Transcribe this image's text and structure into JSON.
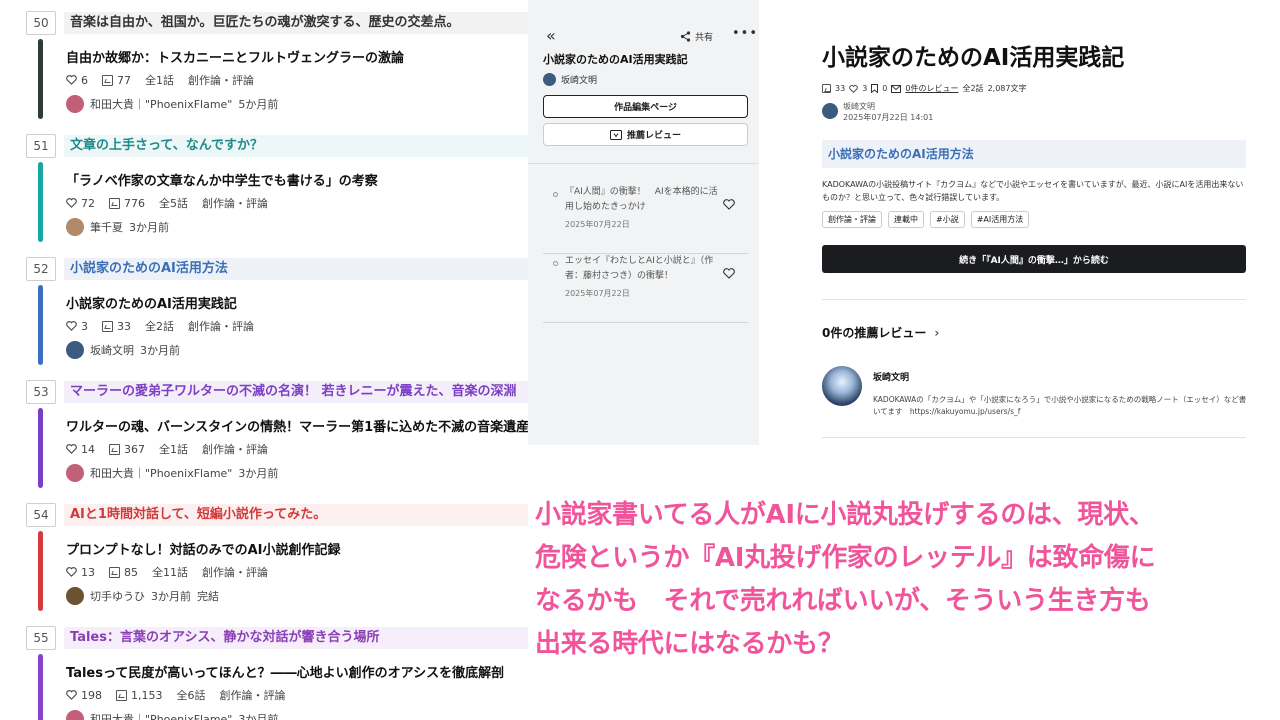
{
  "ranking": [
    {
      "rank": "50",
      "headline": "音楽は自由か、祖国か。巨匠たちの魂が激突する、歴史の交差点。",
      "headline_color": "#333333",
      "headline_bg": "#f2f2f2",
      "bar_color": "#2f3b3b",
      "title": "自由か故郷か：トスカニーニとフルトヴェングラーの激論",
      "hearts": "6",
      "pv": "77",
      "episodes": "全1話",
      "genre": "創作論・評論",
      "author": "和田大貴｜\"PhoenixFlame\"",
      "time": "5か月前",
      "status": "",
      "avatar_color": "#c2607a"
    },
    {
      "rank": "51",
      "headline": "文章の上手さって、なんですか？",
      "headline_color": "#1f8a8a",
      "headline_bg": "#eef7f7",
      "bar_color": "#17a6a6",
      "title": "「ラノベ作家の文章なんか中学生でも書ける」の考察",
      "hearts": "72",
      "pv": "776",
      "episodes": "全5話",
      "genre": "創作論・評論",
      "author": "筆千夏",
      "time": "3か月前",
      "status": "",
      "avatar_color": "#b08a6a"
    },
    {
      "rank": "52",
      "headline": "小説家のためのAI活用方法",
      "headline_color": "#3a6fb5",
      "headline_bg": "#eef2f8",
      "bar_color": "#3c6fc0",
      "title": "小説家のためのAI活用実践記",
      "hearts": "3",
      "pv": "33",
      "episodes": "全2話",
      "genre": "創作論・評論",
      "author": "坂崎文明",
      "time": "3か月前",
      "status": "",
      "avatar_color": "#3d5a80"
    },
    {
      "rank": "53",
      "headline": "マーラーの愛弟子ワルターの不滅の名演！ 若きレニーが震えた、音楽の深淵",
      "headline_color": "#7b3fc2",
      "headline_bg": "#f4eefa",
      "bar_color": "#7a3fc8",
      "title": "ワルターの魂、バーンスタインの情熱！マーラー第1番に込めた不滅の音楽遺産",
      "hearts": "14",
      "pv": "367",
      "episodes": "全1話",
      "genre": "創作論・評論",
      "author": "和田大貴｜\"PhoenixFlame\"",
      "time": "3か月前",
      "status": "",
      "avatar_color": "#c2607a"
    },
    {
      "rank": "54",
      "headline": "AIと1時間対話して、短編小説作ってみた。",
      "headline_color": "#d23a3a",
      "headline_bg": "#fcefef",
      "bar_color": "#d63a3a",
      "title": "プロンプトなし！対話のみでのAI小説創作記録",
      "hearts": "13",
      "pv": "85",
      "episodes": "全11話",
      "genre": "創作論・評論",
      "author": "切手ゆうひ",
      "time": "3か月前",
      "status": "完結",
      "avatar_color": "#6b5230"
    },
    {
      "rank": "55",
      "headline": "Tales：言葉のオアシス、静かな対話が響き合う場所",
      "headline_color": "#8a3fb5",
      "headline_bg": "#f6eefa",
      "bar_color": "#8a42c8",
      "title": "Talesって民度が高いってほんと？――心地よい創作のオアシスを徹底解剖",
      "hearts": "198",
      "pv": "1,153",
      "episodes": "全6話",
      "genre": "創作論・評論",
      "author": "和田大貴｜\"PhoenixFlame\"",
      "time": "3か月前",
      "status": "",
      "avatar_color": "#c2607a"
    }
  ],
  "sidebar": {
    "back_icon": "double-chevron-left",
    "share_label": "共有",
    "more_label": "•••",
    "work_title": "小説家のためのAI活用実践記",
    "author": "坂崎文明",
    "edit_button": "作品編集ページ",
    "review_button": "推薦レビュー",
    "episodes": [
      {
        "title": "『AI人間』の衝撃！　AIを本格的に活用し始めたきっかけ",
        "date": "2025年07月22日"
      },
      {
        "title": "エッセイ『わたしとAIと小説と』（作者：藤村さつき）の衝撃！",
        "date": "2025年07月22日"
      }
    ]
  },
  "work": {
    "title": "小説家のためのAI活用実践記",
    "pv": "33",
    "hearts": "3",
    "bookmarks": "0",
    "reviews": "0件のレビュー",
    "episodes": "全2話",
    "chars": "2,087文字",
    "author": "坂崎文明",
    "updated": "2025年07月22日 14:01",
    "catchphrase": "小説家のためのAI活用方法",
    "description": "KADOKAWAの小説投稿サイト『カクヨム』などで小説やエッセイを書いていますが、最近、小説にAIを活用出来ないものか？と思い立って、色々試行錯誤しています。",
    "tags": [
      "創作論・評論",
      "連載中",
      "#小説",
      "#AI活用方法"
    ],
    "read_button": "続き「『AI人間』の衝撃…」から読む",
    "reviews_heading": "0件の推薦レビュー",
    "bio_name": "坂崎文明",
    "bio_text": "KADOKAWAの「カクヨム」や「小説家になろう」で小説や小説家になるための戦略ノート（エッセイ）など書いてます　https://kakuyomu.jp/users/s_f"
  },
  "overlay": {
    "lines": [
      "小説家書いてる人がAIに小説丸投げするのは、現状、",
      "危険というか『AI丸投げ作家のレッテル』は致命傷に",
      "なるかも　それで売れればいいが、そういう生き方も",
      "出来る時代にはなるかも？"
    ],
    "color": "#f0559b"
  }
}
